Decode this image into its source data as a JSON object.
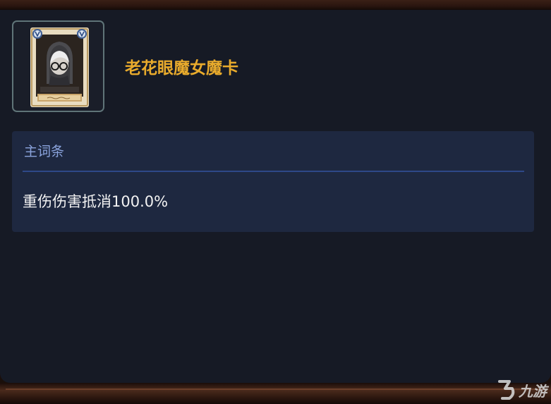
{
  "item": {
    "name": "老花眼魔女魔卡",
    "icon": "witch-card-icon"
  },
  "attributes": {
    "heading": "主词条",
    "lines": [
      "重伤伤害抵消100.0%"
    ]
  },
  "watermark": {
    "text": "九游",
    "icon": "jiuyou-logo-icon"
  },
  "colors": {
    "name": "#e9ab2c",
    "heading": "#8aa3dc",
    "panel": "#161a25",
    "attr_box": "#1e2840",
    "frame": "#5f7478"
  }
}
